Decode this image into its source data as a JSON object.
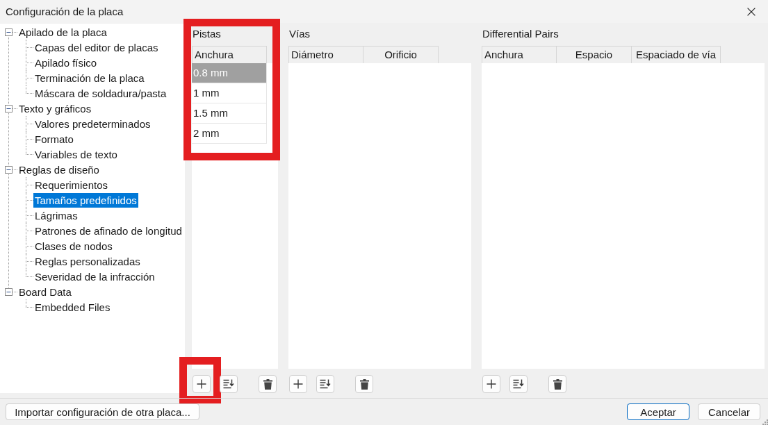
{
  "window": {
    "title": "Configuración de la placa"
  },
  "sidebar": {
    "items": [
      {
        "label": "Apilado de la placa",
        "selected": false,
        "expanded": true,
        "children": [
          {
            "label": "Capas del editor de placas",
            "selected": false
          },
          {
            "label": "Apilado físico",
            "selected": false
          },
          {
            "label": "Terminación de la placa",
            "selected": false
          },
          {
            "label": "Máscara de soldadura/pasta",
            "selected": false
          }
        ]
      },
      {
        "label": "Texto y gráficos",
        "selected": false,
        "expanded": true,
        "children": [
          {
            "label": "Valores predeterminados",
            "selected": false
          },
          {
            "label": "Formato",
            "selected": false
          },
          {
            "label": "Variables de texto",
            "selected": false
          }
        ]
      },
      {
        "label": "Reglas de diseño",
        "selected": false,
        "expanded": true,
        "children": [
          {
            "label": "Requerimientos",
            "selected": false
          },
          {
            "label": "Tamaños predefinidos",
            "selected": true
          },
          {
            "label": "Lágrimas",
            "selected": false
          },
          {
            "label": "Patrones de afinado de longitud",
            "selected": false
          },
          {
            "label": "Clases de nodos",
            "selected": false
          },
          {
            "label": "Reglas personalizadas",
            "selected": false
          },
          {
            "label": "Severidad de la infracción",
            "selected": false
          }
        ]
      },
      {
        "label": "Board Data",
        "selected": false,
        "expanded": true,
        "children": [
          {
            "label": "Embedded Files",
            "selected": false
          }
        ]
      }
    ]
  },
  "panels": [
    {
      "title": "Pistas",
      "highlighted": true,
      "columns": [
        "Anchura"
      ],
      "rows": [
        {
          "cells": [
            "0.8 mm"
          ],
          "selected": true
        },
        {
          "cells": [
            "1 mm"
          ],
          "selected": false
        },
        {
          "cells": [
            "1.5 mm"
          ],
          "selected": false
        },
        {
          "cells": [
            "2 mm"
          ],
          "selected": false
        }
      ],
      "buttons": [
        {
          "kind": "add",
          "highlighted": true
        },
        {
          "kind": "sort",
          "highlighted": false
        },
        {
          "kind": "delete",
          "highlighted": false
        }
      ]
    },
    {
      "title": "Vías",
      "highlighted": false,
      "columns": [
        "Diámetro",
        "Orificio"
      ],
      "buttons": [
        {
          "kind": "add",
          "highlighted": false
        },
        {
          "kind": "sort",
          "highlighted": false
        },
        {
          "kind": "delete",
          "highlighted": false
        }
      ]
    },
    {
      "title": "Differential Pairs",
      "highlighted": false,
      "columns": [
        "Anchura",
        "Espacio",
        "Espaciado de vía"
      ],
      "buttons": [
        {
          "kind": "add",
          "highlighted": false
        },
        {
          "kind": "sort",
          "highlighted": false
        },
        {
          "kind": "delete",
          "highlighted": false
        }
      ]
    }
  ],
  "footer": {
    "import_button": "Importar configuración de otra placa...",
    "buttons": [
      {
        "label": "Aceptar",
        "default": true
      },
      {
        "label": "Cancelar",
        "default": false
      }
    ]
  }
}
